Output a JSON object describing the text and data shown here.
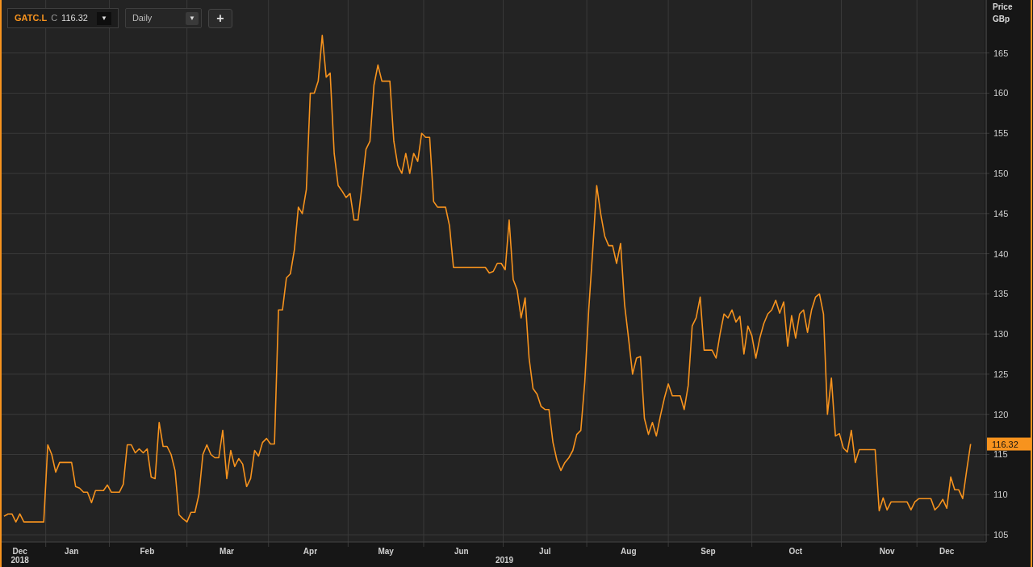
{
  "toolbar": {
    "instrument": {
      "field": "C",
      "value": "116.32",
      "caret": "▼"
    },
    "interval": {
      "value": "Daily",
      "caret": "▼"
    },
    "add_button": "+"
  },
  "chart": {
    "unit": "GBp",
    "last_price_tag": "116.32",
    "year_labels": [
      "2018",
      "2019"
    ],
    "chart_data": {
      "type": "line",
      "ylabel": "Price",
      "grid": true,
      "categories": [
        null,
        null,
        null,
        null,
        "Dec",
        null,
        null,
        null,
        null,
        null,
        null,
        null,
        null,
        null,
        null,
        null,
        null,
        "Jan",
        null,
        null,
        null,
        null,
        null,
        null,
        null,
        null,
        null,
        null,
        null,
        null,
        null,
        null,
        null,
        null,
        null,
        null,
        "Feb",
        null,
        null,
        null,
        null,
        null,
        null,
        null,
        null,
        null,
        null,
        null,
        null,
        null,
        null,
        null,
        null,
        null,
        null,
        null,
        "Mar",
        null,
        null,
        null,
        null,
        null,
        null,
        null,
        null,
        null,
        null,
        null,
        null,
        null,
        null,
        null,
        null,
        null,
        null,
        null,
        null,
        "Apr",
        null,
        null,
        null,
        null,
        null,
        null,
        null,
        null,
        null,
        null,
        null,
        null,
        null,
        null,
        null,
        null,
        null,
        null,
        "May",
        null,
        null,
        null,
        null,
        null,
        null,
        null,
        null,
        null,
        null,
        null,
        null,
        null,
        null,
        null,
        null,
        null,
        null,
        "Jun",
        null,
        null,
        null,
        null,
        null,
        null,
        null,
        null,
        null,
        null,
        null,
        null,
        null,
        null,
        null,
        null,
        null,
        null,
        null,
        null,
        "Jul",
        null,
        null,
        null,
        null,
        null,
        null,
        null,
        null,
        null,
        null,
        null,
        null,
        null,
        null,
        null,
        null,
        null,
        null,
        null,
        null,
        "Aug",
        null,
        null,
        null,
        null,
        null,
        null,
        null,
        null,
        null,
        null,
        null,
        null,
        null,
        null,
        null,
        null,
        null,
        null,
        null,
        "Sep",
        null,
        null,
        null,
        null,
        null,
        null,
        null,
        null,
        null,
        null,
        null,
        null,
        null,
        null,
        null,
        null,
        null,
        null,
        null,
        null,
        null,
        "Oct",
        null,
        null,
        null,
        null,
        null,
        null,
        null,
        null,
        null,
        null,
        null,
        null,
        null,
        null,
        null,
        null,
        null,
        null,
        null,
        null,
        null,
        null,
        "Nov",
        null,
        null,
        null,
        null,
        null,
        null,
        null,
        null,
        null,
        null,
        null,
        null,
        null,
        null,
        "Dec",
        null,
        null,
        null,
        null,
        null,
        null
      ],
      "series": [
        {
          "name": "GATC.L",
          "color": "#f7931e",
          "values": [
            107.3,
            107.6,
            107.6,
            106.6,
            107.6,
            106.6,
            106.6,
            106.6,
            106.6,
            106.6,
            106.6,
            116.2,
            115,
            112.8,
            114,
            114,
            114,
            114,
            111,
            110.8,
            110.3,
            110.3,
            109,
            110.5,
            110.5,
            110.5,
            111.2,
            110.3,
            110.3,
            110.3,
            111.3,
            116.2,
            116.2,
            115.2,
            115.7,
            115.2,
            115.7,
            112.2,
            112,
            119,
            116,
            116,
            115,
            113,
            107.5,
            107,
            106.6,
            107.8,
            107.8,
            110,
            115,
            116.2,
            115,
            114.6,
            114.6,
            118,
            112,
            115.5,
            113.5,
            114.5,
            113.8,
            111,
            112,
            115.5,
            114.8,
            116.5,
            117,
            116.3,
            116.3,
            133,
            133,
            137,
            137.5,
            140.5,
            145.8,
            145,
            148,
            160,
            160,
            161.5,
            167.2,
            162,
            162.5,
            152.5,
            148.5,
            147.8,
            147,
            147.5,
            144.2,
            144.2,
            148.5,
            153,
            154,
            161,
            163.5,
            161.5,
            161.5,
            161.5,
            154,
            151,
            150,
            152.5,
            150,
            152.5,
            151.5,
            155,
            154.5,
            154.5,
            146.5,
            145.8,
            145.8,
            145.8,
            143.5,
            138.3,
            138.3,
            138.3,
            138.3,
            138.3,
            138.3,
            138.3,
            138.3,
            138.3,
            137.6,
            137.8,
            138.8,
            138.8,
            138,
            144.2,
            136.8,
            135.5,
            132,
            134.5,
            127,
            123.2,
            122.5,
            121,
            120.6,
            120.6,
            116.5,
            114.3,
            113,
            114,
            114.6,
            115.5,
            117.5,
            118,
            124,
            133,
            140.5,
            148.5,
            145,
            142.2,
            141,
            141,
            138.8,
            141.3,
            133.7,
            129.5,
            125,
            127,
            127.2,
            119.5,
            117.5,
            119,
            117.3,
            119.8,
            122,
            123.8,
            122.3,
            122.3,
            122.3,
            120.6,
            123.6,
            131,
            132,
            134.6,
            128,
            128,
            128,
            127,
            130,
            132.5,
            132,
            133,
            131.5,
            132.2,
            127.5,
            131,
            129.8,
            127,
            129.5,
            131.3,
            132.5,
            133,
            134.2,
            132.6,
            134,
            128.5,
            132.3,
            129.5,
            132.5,
            133,
            130.2,
            133,
            134.6,
            135,
            132.5,
            120,
            124.5,
            117.3,
            117.6,
            115.8,
            115.3,
            118,
            114,
            115.6,
            115.6,
            115.6,
            115.6,
            115.6,
            108,
            109.6,
            108.1,
            109.1,
            109.1,
            109.1,
            109.1,
            109.1,
            108.1,
            109.1,
            109.5,
            109.5,
            109.5,
            109.5,
            108.1,
            108.6,
            109.4,
            108.3,
            112.2,
            110.6,
            110.6,
            109.5,
            113,
            116.3
          ]
        }
      ],
      "ylim": [
        104.1,
        171.6
      ],
      "yticks": [
        105,
        110,
        115,
        120,
        125,
        130,
        135,
        140,
        145,
        150,
        155,
        160,
        165
      ]
    }
  }
}
